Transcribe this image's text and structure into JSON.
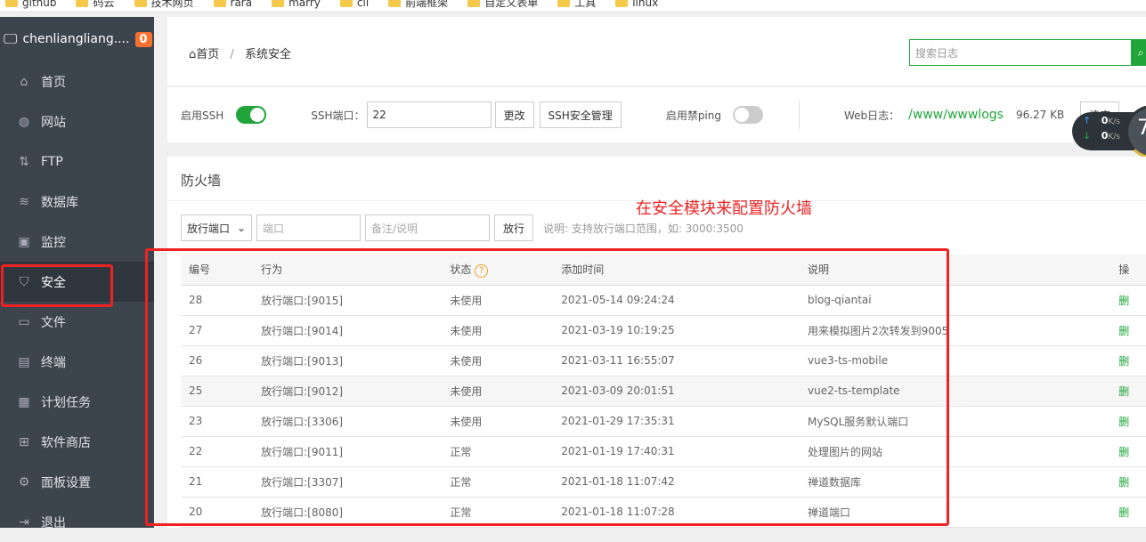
{
  "bookmarks": [
    "github",
    "码云",
    "技术网页",
    "rara",
    "marry",
    "cli",
    "前端框架",
    "自定义表单",
    "工具",
    "linux"
  ],
  "sidebar": {
    "host": "chenliangliang....",
    "badge": "0",
    "items": [
      {
        "label": "首页",
        "icon": "home-icon"
      },
      {
        "label": "网站",
        "icon": "globe-icon"
      },
      {
        "label": "FTP",
        "icon": "ftp-icon"
      },
      {
        "label": "数据库",
        "icon": "database-icon"
      },
      {
        "label": "监控",
        "icon": "monitor-icon"
      },
      {
        "label": "安全",
        "icon": "shield-icon",
        "active": true
      },
      {
        "label": "文件",
        "icon": "folder-icon"
      },
      {
        "label": "终端",
        "icon": "terminal-icon"
      },
      {
        "label": "计划任务",
        "icon": "calendar-icon"
      },
      {
        "label": "软件商店",
        "icon": "grid-icon"
      },
      {
        "label": "面板设置",
        "icon": "gear-icon"
      },
      {
        "label": "退出",
        "icon": "logout-icon"
      }
    ]
  },
  "breadcrumb": {
    "home": "首页",
    "sep": "/",
    "current": "系统安全"
  },
  "search": {
    "placeholder": "搜索日志"
  },
  "ssh": {
    "enable_label": "启用SSH",
    "enabled": true,
    "port_label": "SSH端口：",
    "port": "22",
    "change": "更改",
    "manage": "SSH安全管理",
    "ping_label": "启用禁ping",
    "ping_enabled": false,
    "weblog_label": "Web日志：",
    "weblog_path": "/www/wwwlogs",
    "weblog_size": "96.27 KB",
    "clear": "清空"
  },
  "net": {
    "up": "0",
    "down": "0",
    "unit": "K/s",
    "gauge": "7"
  },
  "firewall": {
    "title": "防火墙",
    "annotation": "在安全模块来配置防火墙",
    "select": "放行端口",
    "port_placeholder": "端口",
    "note_placeholder": "备注/说明",
    "submit": "放行",
    "hint": "说明: 支持放行端口范围，如: 3000:3500",
    "columns": [
      "编号",
      "行为",
      "状态",
      "添加时间",
      "说明",
      "操"
    ],
    "rows": [
      [
        "28",
        "放行端口:[9015]",
        "未使用",
        "2021-05-14 09:24:24",
        "blog-qiantai"
      ],
      [
        "27",
        "放行端口:[9014]",
        "未使用",
        "2021-03-19 10:19:25",
        "用来模拟图片2次转发到9005"
      ],
      [
        "26",
        "放行端口:[9013]",
        "未使用",
        "2021-03-11 16:55:07",
        "vue3-ts-mobile"
      ],
      [
        "25",
        "放行端口:[9012]",
        "未使用",
        "2021-03-09 20:01:51",
        "vue2-ts-template"
      ],
      [
        "23",
        "放行端口:[3306]",
        "未使用",
        "2021-01-29 17:35:31",
        "MySQL服务默认端口"
      ],
      [
        "22",
        "放行端口:[9011]",
        "正常",
        "2021-01-19 17:40:31",
        "处理图片的网站"
      ],
      [
        "21",
        "放行端口:[3307]",
        "正常",
        "2021-01-18 11:07:42",
        "禅道数据库"
      ],
      [
        "20",
        "放行端口:[8080]",
        "正常",
        "2021-01-18 11:07:28",
        "禅道端口"
      ]
    ],
    "delete": "删"
  },
  "colors": {
    "green": "#20a53a",
    "red": "#e22",
    "orange": "#f7712f"
  }
}
